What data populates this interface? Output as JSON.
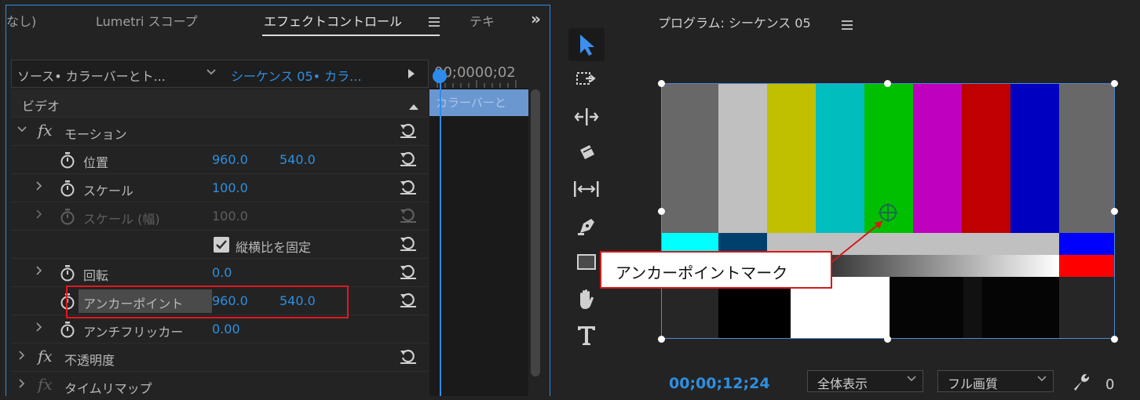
{
  "left_panel": {
    "tabs": [
      {
        "label": "なし)"
      },
      {
        "label": "Lumetri スコープ"
      },
      {
        "label": "エフェクトコントロール"
      },
      {
        "label": "テキ"
      }
    ],
    "overflow": "»",
    "source_label": "ソース• カラーバーとト...",
    "sequence_label": "シーケンス 05• カラ...",
    "timecode": "00;0000;02",
    "clip_label": "カラーバーと",
    "section_video": "ビデオ",
    "effects": {
      "motion": "モーション",
      "position": {
        "label": "位置",
        "x": "960.0",
        "y": "540.0"
      },
      "scale": {
        "label": "スケール",
        "value": "100.0"
      },
      "scale_width": {
        "label": "スケール (幅)",
        "value": "100.0"
      },
      "uniform_scale": {
        "label": "縦横比を固定",
        "checked": true
      },
      "rotation": {
        "label": "回転",
        "value": "0.0"
      },
      "anchor": {
        "label": "アンカーポイント",
        "x": "960.0",
        "y": "540.0"
      },
      "antiflicker": {
        "label": "アンチフリッカー",
        "value": "0.00"
      },
      "opacity": "不透明度",
      "time_remap": "タイムリマップ"
    }
  },
  "program": {
    "title": "プログラム: シーケンス 05",
    "timecode": "00;00;12;24",
    "zoom": "全体表示",
    "quality": "フル画質",
    "wrench_count": "0"
  },
  "callout": {
    "text": "アンカーポイントマーク"
  },
  "colors": {
    "accent_blue": "#2d8ceb",
    "value_blue": "#2e8fe0",
    "highlight_red": "#e0191f"
  }
}
